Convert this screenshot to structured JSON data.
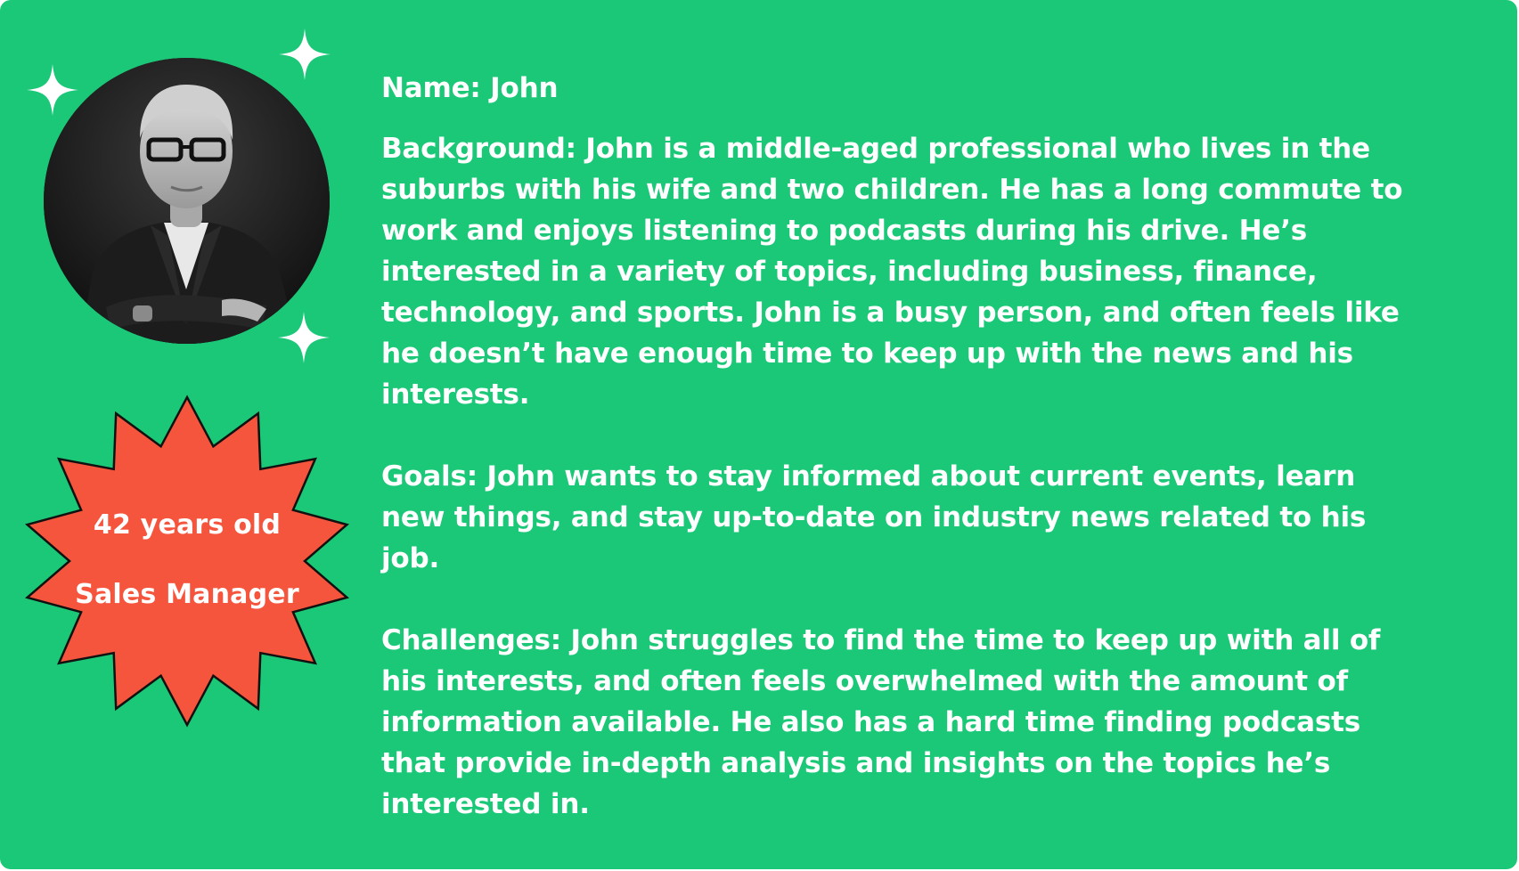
{
  "persona": {
    "name_line": "Name: John",
    "background": "Background: John is a middle-aged professional who lives in the suburbs with his wife and two children. He has a long commute to work and enjoys listening to podcasts during his drive. He’s interested in a variety of topics, including business, finance, technology, and sports. John is a busy person, and often feels like he doesn’t have enough time to keep up with the news and his interests.",
    "goals": "Goals: John wants to stay informed about current events, learn new things, and stay up-to-date on industry news related to his job.",
    "challenges": "Challenges: John struggles to find the time to keep up with all of his interests, and often feels overwhelmed with the amount of information available. He also has a hard time finding podcasts that provide in-depth analysis and insights on the topics he’s interested in."
  },
  "badge": {
    "age": "42 years old",
    "role": "Sales Manager"
  },
  "colors": {
    "background": "#1bc878",
    "badge": "#f5553d",
    "text": "#ffffff"
  },
  "icons": [
    "sparkle-icon",
    "avatar-photo",
    "starburst-badge"
  ]
}
